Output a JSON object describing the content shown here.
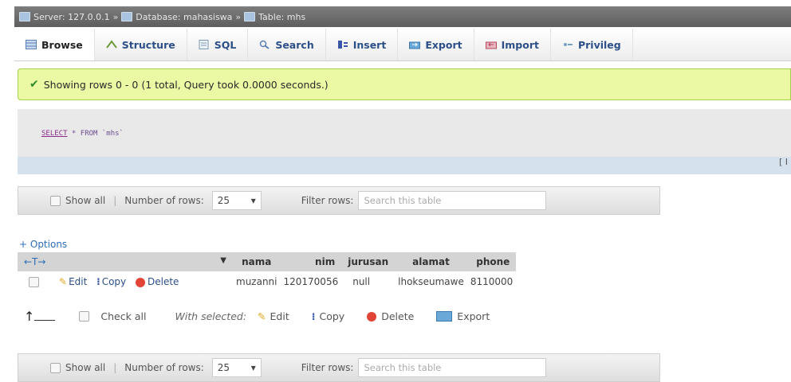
{
  "breadcrumb": {
    "server": "Server: 127.0.0.1",
    "database": "Database: mahasiswa",
    "table": "Table: mhs",
    "separator": "»"
  },
  "tabs": [
    {
      "label": "Browse",
      "icon": "browse-icon",
      "active": true
    },
    {
      "label": "Structure",
      "icon": "structure-icon"
    },
    {
      "label": "SQL",
      "icon": "sql-icon"
    },
    {
      "label": "Search",
      "icon": "search-icon"
    },
    {
      "label": "Insert",
      "icon": "insert-icon"
    },
    {
      "label": "Export",
      "icon": "export-icon"
    },
    {
      "label": "Import",
      "icon": "import-icon"
    },
    {
      "label": "Privileg",
      "icon": "privileges-icon"
    }
  ],
  "message": {
    "text": "Showing rows 0 - 0 (1 total, Query took 0.0000 seconds.)"
  },
  "sql": {
    "keyword": "SELECT",
    "rest": " * FROM `mhs`",
    "bar_text": "[ I"
  },
  "nav_top": {
    "show_all": "Show all",
    "separator": "|",
    "rows_label": "Number of rows:",
    "rows_value": "25",
    "filter_label": "Filter rows:",
    "filter_placeholder": "Search this table"
  },
  "options_label": "+ Options",
  "table": {
    "sort_handle": "←T→",
    "sort_arrow": "▼",
    "headers": [
      "nama",
      "nim",
      "jurusan",
      "alamat",
      "phone"
    ],
    "row_actions": {
      "edit": "Edit",
      "copy": "Copy",
      "delete": "Delete"
    },
    "rows": [
      {
        "nama": "muzanni",
        "nim": "120170056",
        "jurusan": "null",
        "alamat": "lhokseumawe",
        "phone": "8110000"
      }
    ]
  },
  "with_selected": {
    "arrow": "↑",
    "check_all": "Check all",
    "label": "With selected:",
    "edit": "Edit",
    "copy": "Copy",
    "delete": "Delete",
    "export": "Export"
  },
  "nav_bottom": {
    "show_all": "Show all",
    "separator": "|",
    "rows_label": "Number of rows:",
    "rows_value": "25",
    "filter_label": "Filter rows:",
    "filter_placeholder": "Search this table"
  },
  "colors": {
    "tab_text": "#2c4f88",
    "success_bg": "#ebf8a4",
    "delete_icon": "#e24536"
  }
}
